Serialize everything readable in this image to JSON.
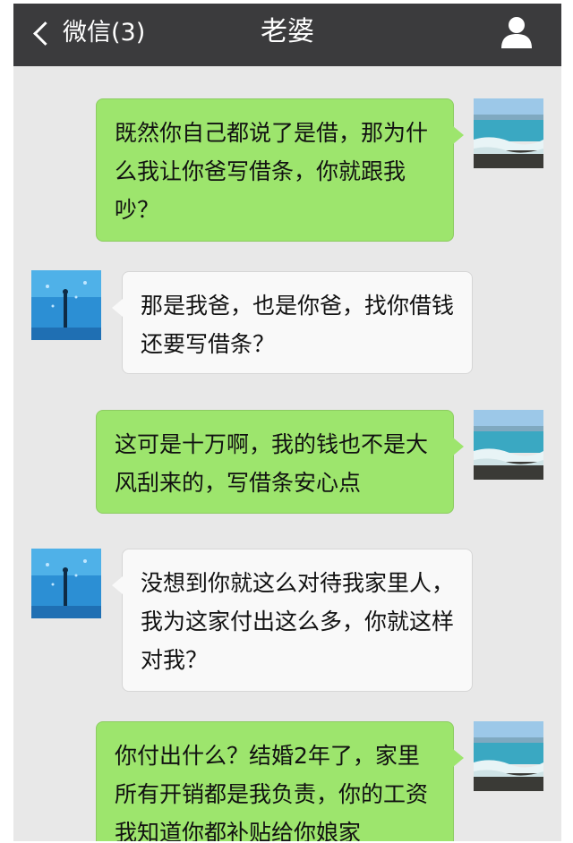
{
  "header": {
    "back_label": "微信(3)",
    "title": "老婆"
  },
  "messages": [
    {
      "from": "me",
      "text": "既然你自己都说了是借，那为什么我让你爸写借条，你就跟我吵？"
    },
    {
      "from": "other",
      "text": "那是我爸，也是你爸，找你借钱还要写借条？"
    },
    {
      "from": "me",
      "text": "这可是十万啊，我的钱也不是大风刮来的，写借条安心点"
    },
    {
      "from": "other",
      "text": "没想到你就这么对待我家里人，我为这家付出这么多，你就这样对我？"
    },
    {
      "from": "me",
      "text": "你付出什么？结婚2年了，家里所有开销都是我负责，你的工资我知道你都补贴给你娘家"
    }
  ],
  "colors": {
    "topbar": "#3b3b3d",
    "chat_background": "#e8e8e8",
    "my_bubble": "#9de56d",
    "other_bubble": "#f9f9f9"
  },
  "icons": {
    "back": "chevron-left-icon",
    "profile": "person-icon"
  }
}
